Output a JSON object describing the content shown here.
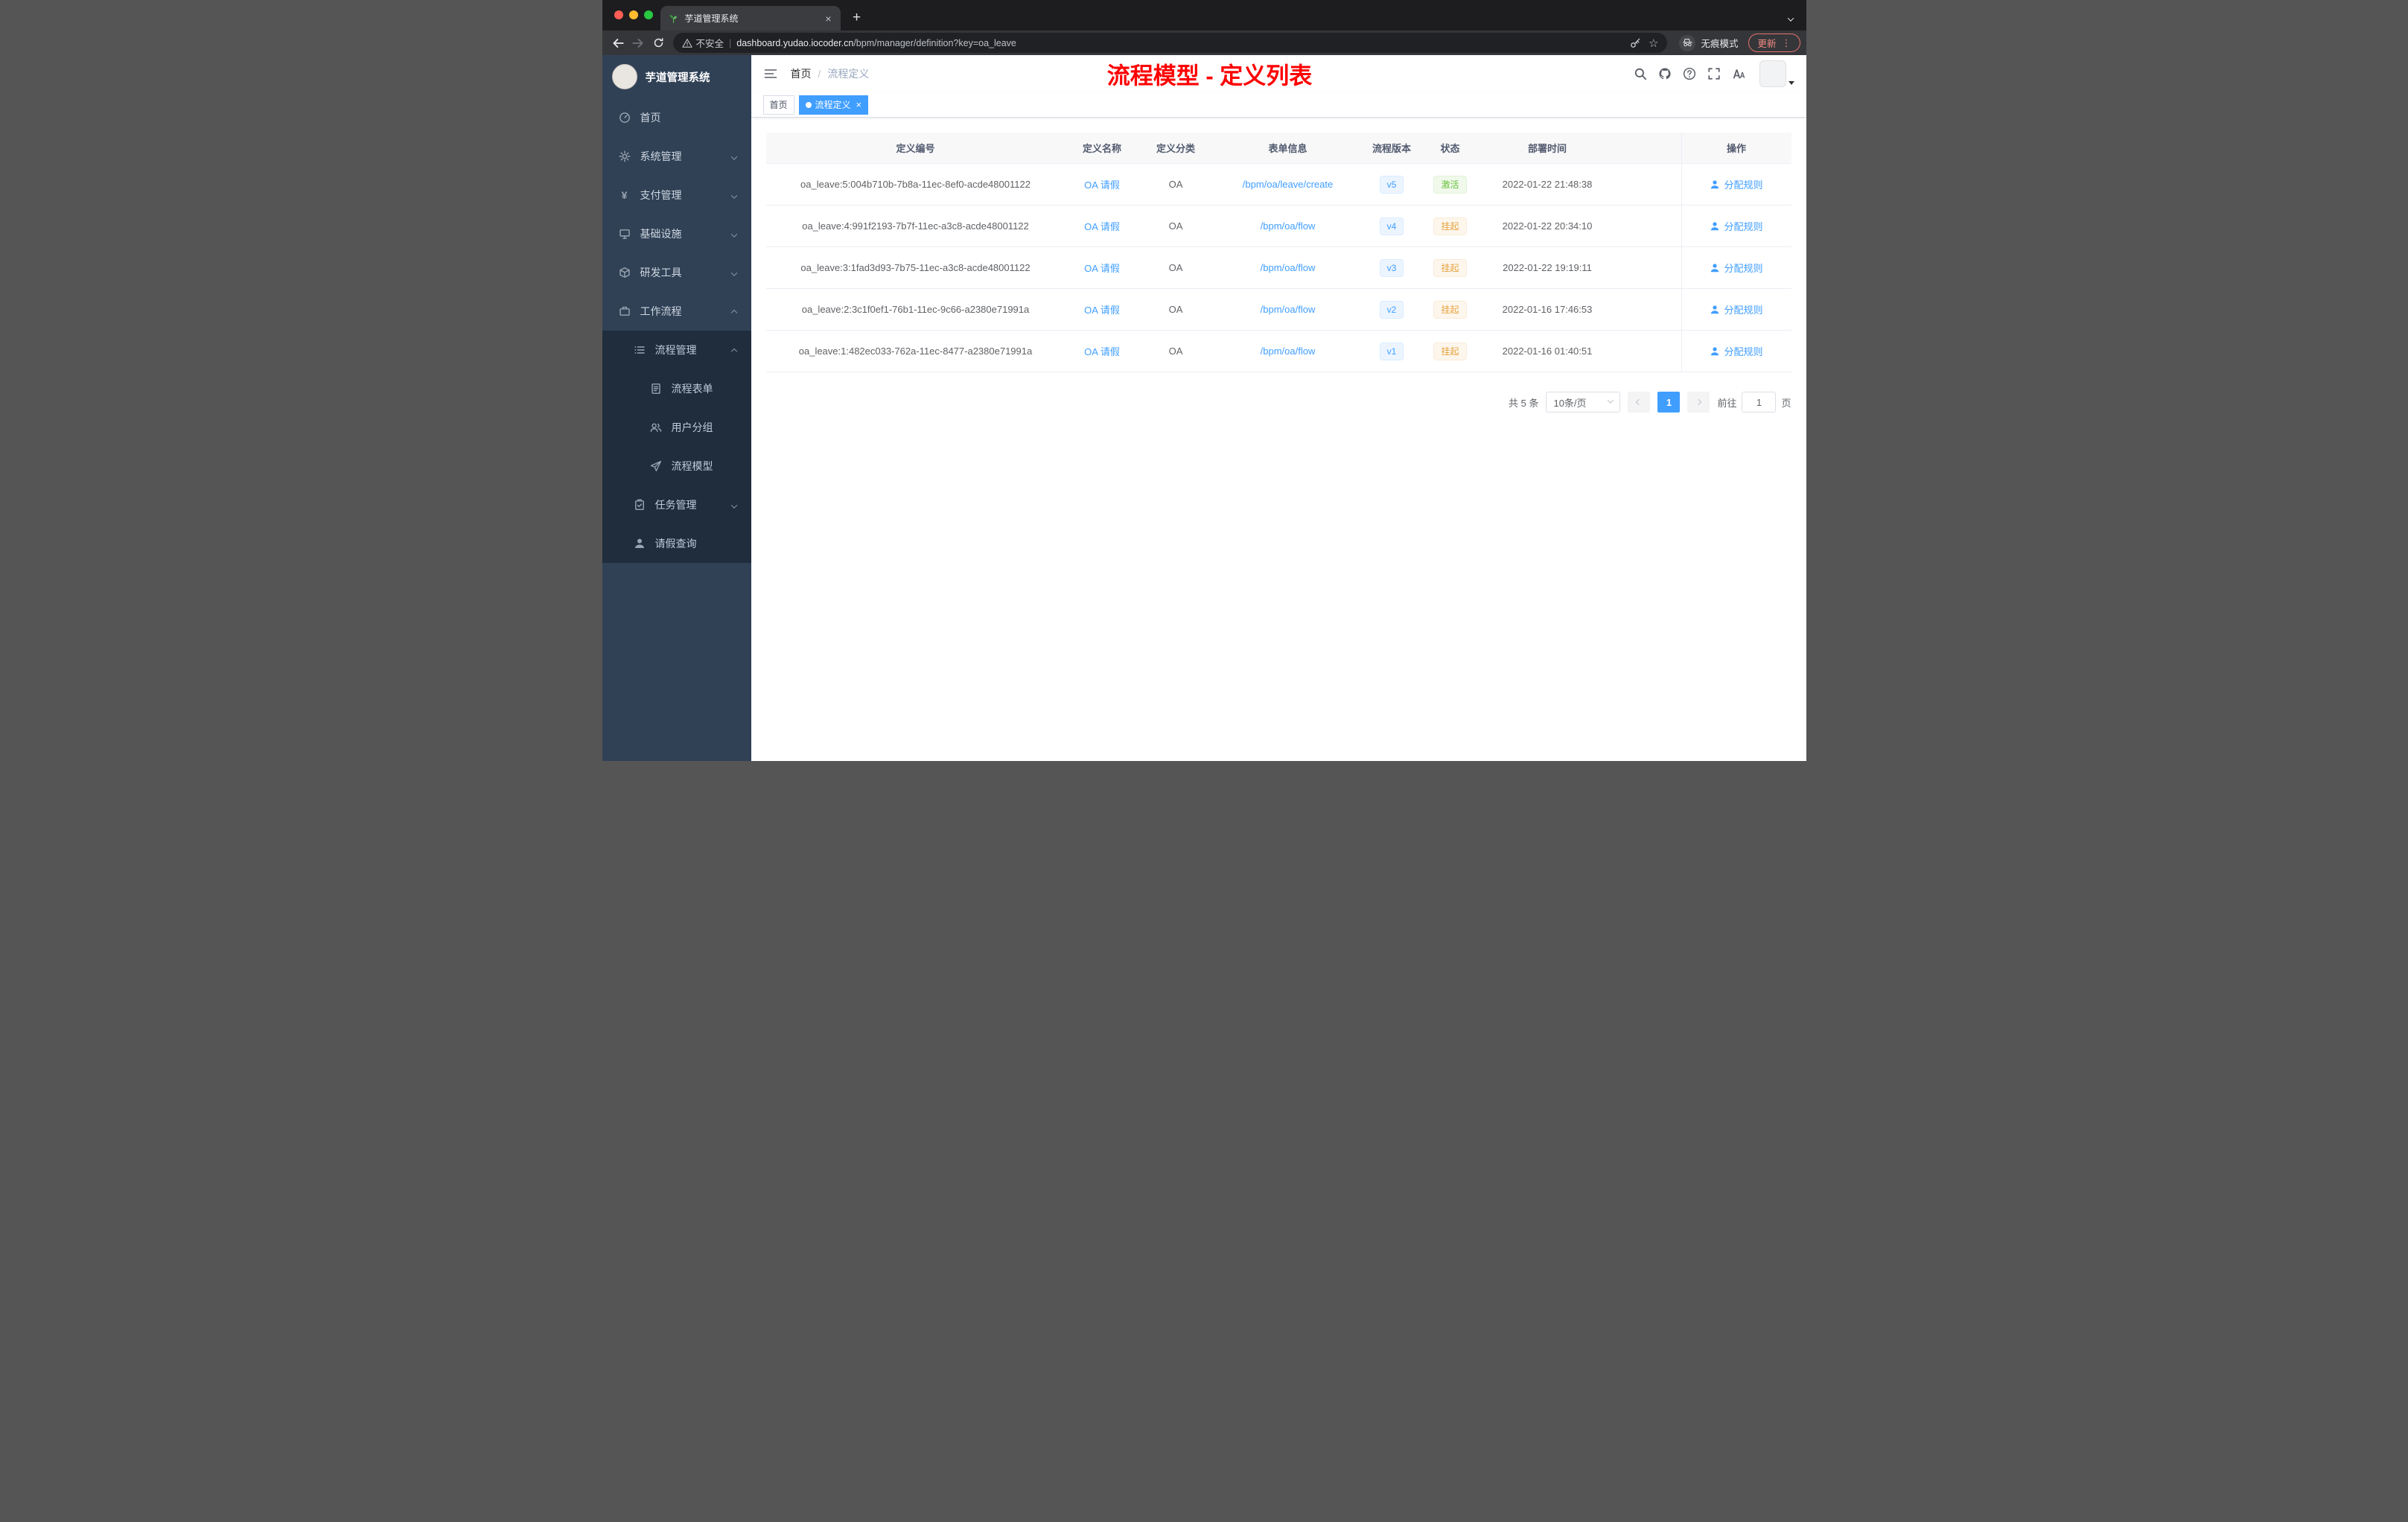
{
  "browser": {
    "tab_title": "芋道管理系统",
    "security_label": "不安全",
    "url_host": "dashboard.yudao.iocoder.cn",
    "url_path": "/bpm/manager/definition?key=oa_leave",
    "incognito_label": "无痕模式",
    "update_label": "更新"
  },
  "icons": {
    "close": "×",
    "plus": "+",
    "dots": "⋮",
    "star": "☆",
    "yen": "¥"
  },
  "sidebar": {
    "logo_title": "芋道管理系统",
    "items": [
      {
        "label": "首页"
      },
      {
        "label": "系统管理"
      },
      {
        "label": "支付管理"
      },
      {
        "label": "基础设施"
      },
      {
        "label": "研发工具"
      },
      {
        "label": "工作流程"
      },
      {
        "label": "流程管理"
      },
      {
        "label": "流程表单"
      },
      {
        "label": "用户分组"
      },
      {
        "label": "流程模型"
      },
      {
        "label": "任务管理"
      },
      {
        "label": "请假查询"
      }
    ]
  },
  "header": {
    "breadcrumb_home": "首页",
    "breadcrumb_sep": "/",
    "breadcrumb_current": "流程定义",
    "annotation": "流程模型 - 定义列表"
  },
  "tags": {
    "home": "首页",
    "active": "流程定义"
  },
  "table": {
    "columns": [
      "定义编号",
      "定义名称",
      "定义分类",
      "表单信息",
      "流程版本",
      "状态",
      "部署时间",
      "操作"
    ],
    "rows": [
      {
        "id": "oa_leave:5:004b710b-7b8a-11ec-8ef0-acde48001122",
        "name": "OA 请假",
        "category": "OA",
        "form": "/bpm/oa/leave/create",
        "version": "v5",
        "status": "激活",
        "deploy_time": "2022-01-22 21:48:38",
        "action": "分配规则"
      },
      {
        "id": "oa_leave:4:991f2193-7b7f-11ec-a3c8-acde48001122",
        "name": "OA 请假",
        "category": "OA",
        "form": "/bpm/oa/flow",
        "version": "v4",
        "status": "挂起",
        "deploy_time": "2022-01-22 20:34:10",
        "action": "分配规则"
      },
      {
        "id": "oa_leave:3:1fad3d93-7b75-11ec-a3c8-acde48001122",
        "name": "OA 请假",
        "category": "OA",
        "form": "/bpm/oa/flow",
        "version": "v3",
        "status": "挂起",
        "deploy_time": "2022-01-22 19:19:11",
        "action": "分配规则"
      },
      {
        "id": "oa_leave:2:3c1f0ef1-76b1-11ec-9c66-a2380e71991a",
        "name": "OA 请假",
        "category": "OA",
        "form": "/bpm/oa/flow",
        "version": "v2",
        "status": "挂起",
        "deploy_time": "2022-01-16 17:46:53",
        "action": "分配规则"
      },
      {
        "id": "oa_leave:1:482ec033-762a-11ec-8477-a2380e71991a",
        "name": "OA 请假",
        "category": "OA",
        "form": "/bpm/oa/flow",
        "version": "v1",
        "status": "挂起",
        "deploy_time": "2022-01-16 01:40:51",
        "action": "分配规则"
      }
    ]
  },
  "pagination": {
    "total": "共 5 条",
    "page_size": "10条/页",
    "current_page": "1",
    "goto_prefix": "前往",
    "goto_page": "1",
    "goto_suffix": "页"
  },
  "colors": {
    "accent": "#409eff",
    "success": "#67c23a",
    "warning": "#e6a23c",
    "annotation_red": "#fe0000",
    "sidebar_bg": "#304156",
    "submenu_bg": "#1f2d3d"
  }
}
